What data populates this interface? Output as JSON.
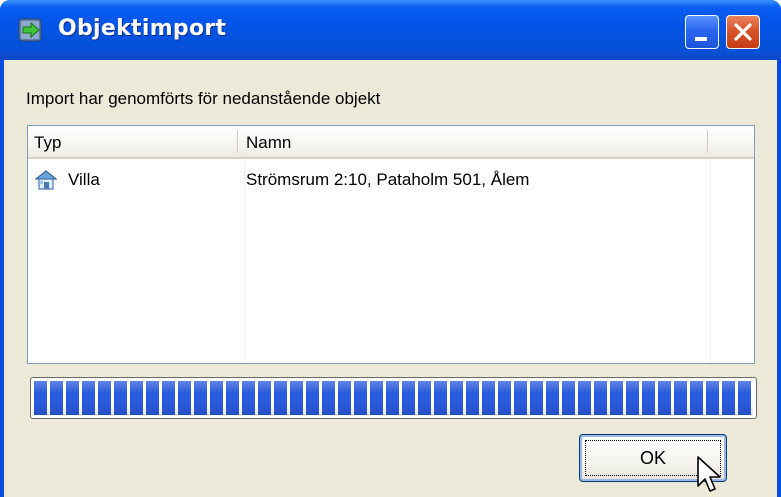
{
  "window": {
    "title": "Objektimport",
    "title_icon": "import-arrow-icon",
    "buttons": {
      "minimize_icon": "minimize-icon",
      "close_icon": "close-icon"
    },
    "colors": {
      "titlebar": "#0455e8",
      "client": "#ece9d8",
      "close": "#d8552b",
      "progress": "#2a5bdc"
    }
  },
  "caption": "Import har genomförts för nedanstående objekt",
  "list": {
    "columns": [
      "Typ",
      "Namn"
    ],
    "rows": [
      {
        "icon": "house-icon",
        "typ": "Villa",
        "namn": "Strömsrum 2:10, Pataholm 501, Ålem"
      }
    ]
  },
  "progress": {
    "value": 1.0
  },
  "ok_button": {
    "label": "OK"
  }
}
